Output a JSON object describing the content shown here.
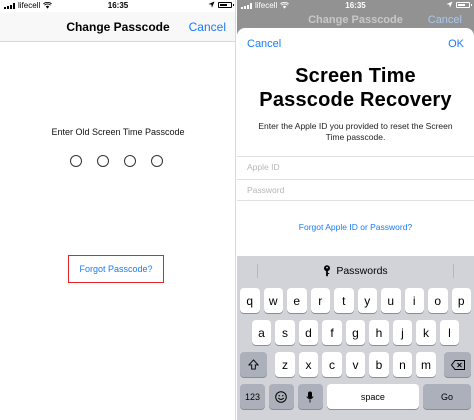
{
  "left": {
    "status": {
      "carrier": "lifecell",
      "time": "16:35"
    },
    "nav": {
      "title": "Change Passcode",
      "cancel": "Cancel"
    },
    "prompt": "Enter Old Screen Time Passcode",
    "forgot": "Forgot Passcode?",
    "highlight_color": "#e0242a"
  },
  "right": {
    "status": {
      "carrier": "lifecell",
      "time": "16:35"
    },
    "behind": {
      "title": "Change Passcode",
      "cancel": "Cancel"
    },
    "sheet": {
      "cancel": "Cancel",
      "ok": "OK",
      "title_line1": "Screen Time",
      "title_line2": "Passcode Recovery",
      "instructions": "Enter the Apple ID you provided to reset the Screen Time passcode.",
      "apple_id_placeholder": "Apple ID",
      "password_placeholder": "Password",
      "forgot": "Forgot Apple ID or Password?"
    },
    "keyboard": {
      "suggestion": "Passwords",
      "row1": [
        "q",
        "w",
        "e",
        "r",
        "t",
        "y",
        "u",
        "i",
        "o",
        "p"
      ],
      "row2": [
        "a",
        "s",
        "d",
        "f",
        "g",
        "h",
        "j",
        "k",
        "l"
      ],
      "row3": [
        "z",
        "x",
        "c",
        "v",
        "b",
        "n",
        "m"
      ],
      "numbers": "123",
      "space": "space",
      "go": "Go"
    }
  },
  "colors": {
    "accent": "#1a7cf5"
  }
}
